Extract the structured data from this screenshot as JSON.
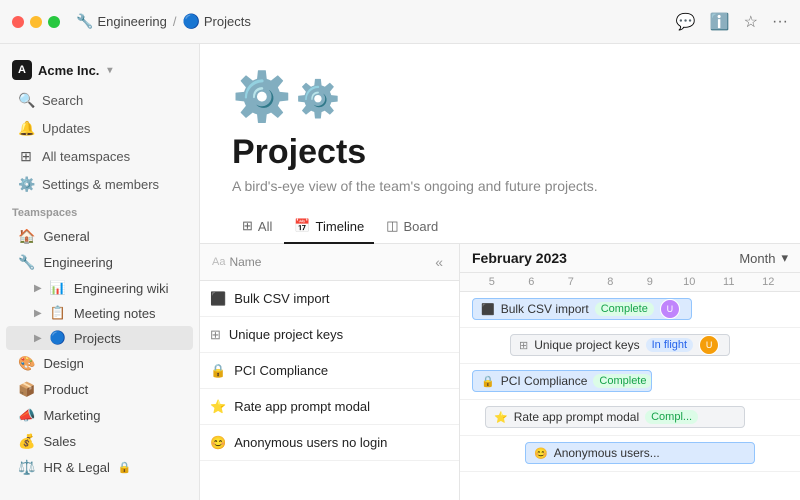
{
  "titlebar": {
    "breadcrumb": [
      {
        "icon": "🔧",
        "label": "Engineering"
      },
      {
        "icon": "🔵",
        "label": "Projects"
      }
    ],
    "actions": [
      "💬",
      "ℹ️",
      "☆",
      "···"
    ]
  },
  "sidebar": {
    "workspace": {
      "name": "Acme Inc.",
      "initials": "A"
    },
    "nav": [
      {
        "icon": "🔍",
        "label": "Search"
      },
      {
        "icon": "🔔",
        "label": "Updates"
      },
      {
        "icon": "⊞",
        "label": "All teamspaces"
      },
      {
        "icon": "⚙️",
        "label": "Settings & members"
      }
    ],
    "teamspaces_label": "Teamspaces",
    "teams": [
      {
        "icon": "🏠",
        "label": "General",
        "indent": false
      },
      {
        "icon": "🔧",
        "label": "Engineering",
        "indent": false
      },
      {
        "icon": "📊",
        "label": "Engineering wiki",
        "indent": true,
        "chevron": true
      },
      {
        "icon": "📋",
        "label": "Meeting notes",
        "indent": true,
        "chevron": true
      },
      {
        "icon": "🔵",
        "label": "Projects",
        "indent": true,
        "active": true
      },
      {
        "icon": "🎨",
        "label": "Design",
        "indent": false
      },
      {
        "icon": "📦",
        "label": "Product",
        "indent": false
      },
      {
        "icon": "📣",
        "label": "Marketing",
        "indent": false
      },
      {
        "icon": "💰",
        "label": "Sales",
        "indent": false
      },
      {
        "icon": "⚖️",
        "label": "HR & Legal",
        "indent": false,
        "lock": true
      }
    ]
  },
  "page": {
    "title": "Projects",
    "description": "A bird's-eye view of the team's ongoing and future projects.",
    "tabs": [
      {
        "icon": "⊞",
        "label": "All"
      },
      {
        "icon": "📅",
        "label": "Timeline",
        "active": true
      },
      {
        "icon": "◫",
        "label": "Board"
      }
    ]
  },
  "timeline": {
    "month_label": "February 2023",
    "view_label": "Month",
    "col_name": "Name",
    "dates": [
      "5",
      "6",
      "7",
      "8",
      "9",
      "10",
      "11",
      "12"
    ],
    "rows": [
      {
        "icon": "⬛",
        "label": "Bulk CSV import",
        "color": "blue",
        "start_pct": 0,
        "width_pct": 55,
        "badge": "Complete",
        "badge_type": "green"
      },
      {
        "icon": "⊞",
        "label": "Unique project keys",
        "color": "gray",
        "start_pct": 15,
        "width_pct": 55,
        "badge": "In flight",
        "badge_type": "blue"
      },
      {
        "icon": "🔒",
        "label": "PCI Compliance",
        "color": "blue",
        "start_pct": 0,
        "width_pct": 45,
        "badge": "Complete",
        "badge_type": "green"
      },
      {
        "icon": "⭐",
        "label": "Rate app prompt modal",
        "color": "gray",
        "start_pct": 5,
        "width_pct": 65,
        "badge": "Compl",
        "badge_type": "green"
      },
      {
        "icon": "😊",
        "label": "Anonymous users no login",
        "color": "blue",
        "start_pct": 20,
        "width_pct": 50,
        "badge": "",
        "badge_type": ""
      }
    ]
  }
}
